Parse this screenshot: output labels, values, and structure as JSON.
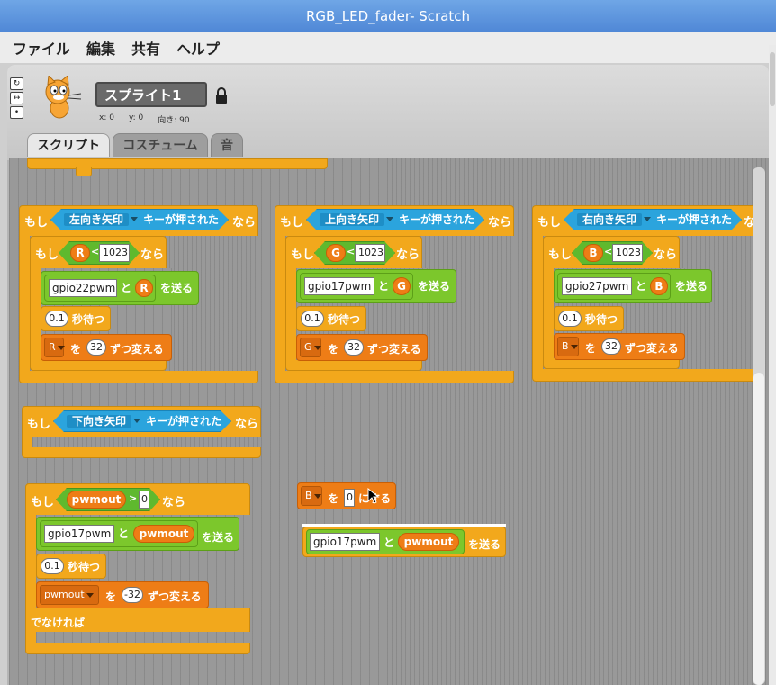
{
  "window": {
    "title": "RGB_LED_fader- Scratch"
  },
  "menu": [
    "ファイル",
    "編集",
    "共有",
    "ヘルプ"
  ],
  "sprite": {
    "name": "スプライト1",
    "x_label": "x: 0",
    "y_label": "y: 0",
    "dir_label": "向き: 90"
  },
  "tabs": [
    "スクリプト",
    "コスチューム",
    "音"
  ],
  "words": {
    "if": "もし",
    "key_pressed": "キーが押された",
    "then": "なら",
    "and": "と",
    "send": "を送る",
    "wait": "秒待つ",
    "wo": "を",
    "change_by": "ずつ変える",
    "set_to": "にする",
    "else": "でなければ"
  },
  "scripts": [
    {
      "key": "左向き矢印",
      "var": "R",
      "limit": "1023",
      "pin": "gpio22pwm",
      "wait": "0.1",
      "step": "32"
    },
    {
      "key": "上向き矢印",
      "var": "G",
      "limit": "1023",
      "pin": "gpio17pwm",
      "wait": "0.1",
      "step": "32"
    },
    {
      "key": "右向き矢印",
      "var": "B",
      "limit": "1023",
      "pin": "gpio27pwm",
      "wait": "0.1",
      "step": "32"
    }
  ],
  "down_key": {
    "key": "下向き矢印"
  },
  "pwm_script": {
    "var": "pwmout",
    "compare": "0",
    "pin": "gpio17pwm",
    "wait": "0.1",
    "step": "-32"
  },
  "loose": {
    "set_var": "B",
    "set_value": "0",
    "pin": "gpio17pwm",
    "var": "pwmout"
  },
  "colors": {
    "control": "#f2a81c",
    "sensing": "#2ba4dd",
    "operators": "#5fb92e",
    "data": "#ee7d16"
  }
}
